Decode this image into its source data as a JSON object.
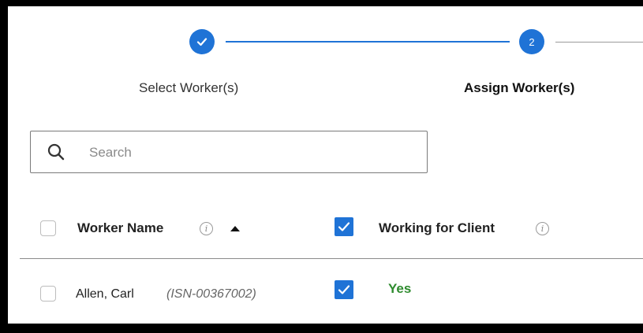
{
  "stepper": {
    "step1": {
      "label": "Select Worker(s)",
      "state": "complete",
      "icon": "check-icon"
    },
    "step2": {
      "number": "2",
      "label": "Assign Worker(s)",
      "state": "current"
    },
    "accent_color": "#1f73d6"
  },
  "search": {
    "placeholder": "Search",
    "value": "",
    "icon": "search-icon"
  },
  "table": {
    "columns": [
      {
        "label": "Worker Name",
        "info_icon": "info-icon",
        "sort": "ascending"
      },
      {
        "label": "Working for Client",
        "info_icon": "info-icon"
      }
    ],
    "header_checkboxes": {
      "worker_name": false,
      "working_for_client": true
    },
    "rows": [
      {
        "name": "Allen, Carl",
        "id": "(ISN-00367002)",
        "selected": false,
        "working_for_client_checked": true,
        "status": "Yes"
      }
    ]
  },
  "colors": {
    "status_yes": "#2e8b2e",
    "checkbox_checked": "#1f73d6"
  }
}
